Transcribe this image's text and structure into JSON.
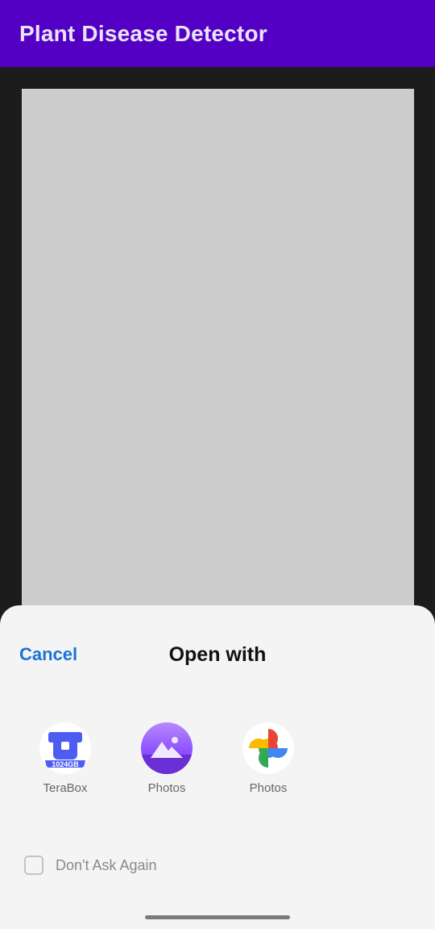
{
  "app_bar": {
    "title": "Plant Disease Detector",
    "color": "#5400c4"
  },
  "dialog": {
    "cancel_label": "Cancel",
    "title": "Open with",
    "apps": [
      {
        "label": "TeraBox",
        "icon": "terabox-icon",
        "badge": "1024GB"
      },
      {
        "label": "Photos",
        "icon": "gallery-photos-icon"
      },
      {
        "label": "Photos",
        "icon": "google-photos-icon"
      }
    ],
    "dont_ask_label": "Don't Ask Again",
    "dont_ask_checked": false
  },
  "colors": {
    "accent": "#1a73d8",
    "sheet_background": "#f4f4f4",
    "image_placeholder": "#cdcdcd"
  }
}
